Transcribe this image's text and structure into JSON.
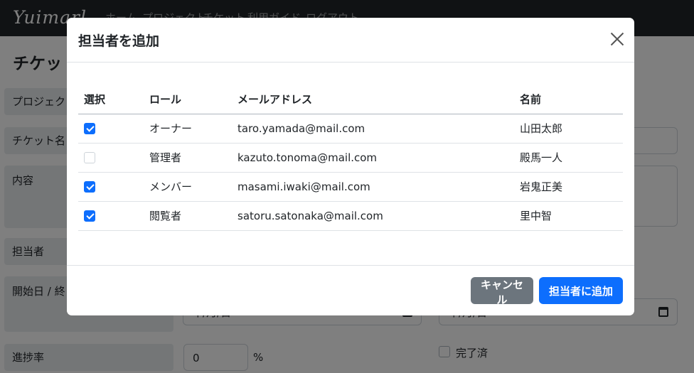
{
  "navbar": {
    "brand": "Yuimarl",
    "links": [
      "ホーム",
      "プロジェクト",
      "チケット",
      "利用ガイド",
      "ログアウト"
    ]
  },
  "page": {
    "title": "チケット",
    "labels": {
      "project": "プロジェクト",
      "ticket_name": "チケット名",
      "content": "内容",
      "assignee": "担当者",
      "dates": "開始日 / 終",
      "progress": "進捗率"
    },
    "date_placeholder": "年/月/日",
    "progress_value": "0",
    "progress_suffix": "%",
    "done_label": "完了済"
  },
  "modal": {
    "title": "担当者を追加",
    "table": {
      "headers": [
        "選択",
        "ロール",
        "メールアドレス",
        "名前"
      ],
      "rows": [
        {
          "selected": true,
          "role": "オーナー",
          "email": "taro.yamada@mail.com",
          "name": "山田太郎"
        },
        {
          "selected": false,
          "role": "管理者",
          "email": "kazuto.tonoma@mail.com",
          "name": "殿馬一人"
        },
        {
          "selected": true,
          "role": "メンバー",
          "email": "masami.iwaki@mail.com",
          "name": "岩鬼正美"
        },
        {
          "selected": true,
          "role": "閲覧者",
          "email": "satoru.satonaka@mail.com",
          "name": "里中智"
        }
      ]
    },
    "buttons": {
      "cancel": "キャンセル",
      "add": "担当者に追加"
    }
  },
  "colors": {
    "primary": "#0d6efd",
    "secondary": "#6c757d",
    "navbar": "#212529"
  }
}
